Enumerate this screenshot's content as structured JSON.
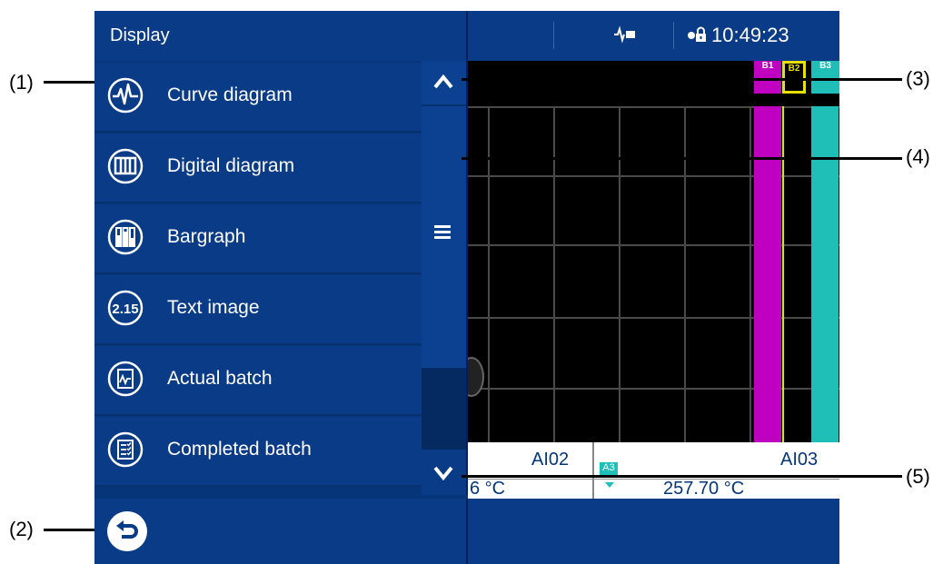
{
  "callouts": [
    "(1)",
    "(2)",
    "(3)",
    "(4)",
    "(5)"
  ],
  "header": {
    "title": "Display",
    "clock": "10:49:23"
  },
  "menu": {
    "items": [
      {
        "label": "Curve diagram",
        "icon": "curve-diagram-icon"
      },
      {
        "label": "Digital diagram",
        "icon": "digital-diagram-icon"
      },
      {
        "label": "Bargraph",
        "icon": "bargraph-icon"
      },
      {
        "label": "Text image",
        "icon": "text-image-icon",
        "icon_text": "2.15"
      },
      {
        "label": "Actual batch",
        "icon": "actual-batch-icon"
      },
      {
        "label": "Completed batch",
        "icon": "completed-batch-icon"
      }
    ]
  },
  "channels": {
    "tags": [
      "B1",
      "B2",
      "B3"
    ],
    "left_name": "AI02",
    "left_value": "6 °C",
    "right_badge": "A3",
    "right_name": "AI03",
    "right_value": "257.70 °C"
  },
  "colors": {
    "menu_bg": "#0a3b86",
    "scroll_bg": "#0c4192",
    "magenta": "#c000c0",
    "cyan": "#1fbfb8",
    "yellow": "#e8e000"
  }
}
